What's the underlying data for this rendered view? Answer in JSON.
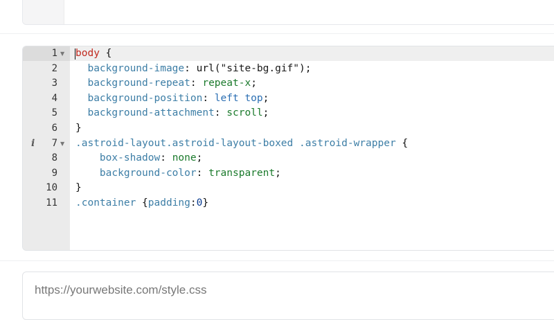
{
  "editor": {
    "lines": [
      {
        "num": "1",
        "fold": true,
        "info": false,
        "tokens": [
          [
            "sel",
            "body"
          ],
          [
            "brace",
            " {"
          ]
        ]
      },
      {
        "num": "2",
        "fold": false,
        "info": false,
        "tokens": [
          [
            "prop",
            "  background-image"
          ],
          [
            "brace",
            ": url("
          ],
          [
            "str",
            "\"site-bg.gif\""
          ],
          [
            "brace",
            ");"
          ]
        ]
      },
      {
        "num": "3",
        "fold": false,
        "info": false,
        "tokens": [
          [
            "prop",
            "  background-repeat"
          ],
          [
            "brace",
            ": "
          ],
          [
            "val",
            "repeat-x"
          ],
          [
            "brace",
            ";"
          ]
        ]
      },
      {
        "num": "4",
        "fold": false,
        "info": false,
        "tokens": [
          [
            "prop",
            "  background-position"
          ],
          [
            "brace",
            ": "
          ],
          [
            "kw",
            "left top"
          ],
          [
            "brace",
            ";"
          ]
        ]
      },
      {
        "num": "5",
        "fold": false,
        "info": false,
        "tokens": [
          [
            "prop",
            "  background-attachment"
          ],
          [
            "brace",
            ": "
          ],
          [
            "val",
            "scroll"
          ],
          [
            "brace",
            ";"
          ]
        ]
      },
      {
        "num": "6",
        "fold": false,
        "info": false,
        "tokens": [
          [
            "brace",
            "}"
          ]
        ]
      },
      {
        "num": "7",
        "fold": true,
        "info": true,
        "tokens": [
          [
            "cls",
            ".astroid-layout.astroid-layout-boxed .astroid-wrapper"
          ],
          [
            "brace",
            " {"
          ]
        ]
      },
      {
        "num": "8",
        "fold": false,
        "info": false,
        "tokens": [
          [
            "prop",
            "    box-shadow"
          ],
          [
            "brace",
            ": "
          ],
          [
            "val",
            "none"
          ],
          [
            "brace",
            ";"
          ]
        ]
      },
      {
        "num": "9",
        "fold": false,
        "info": false,
        "tokens": [
          [
            "prop",
            "    background-color"
          ],
          [
            "brace",
            ": "
          ],
          [
            "val",
            "transparent"
          ],
          [
            "brace",
            ";"
          ]
        ]
      },
      {
        "num": "10",
        "fold": false,
        "info": false,
        "tokens": [
          [
            "brace",
            "}"
          ]
        ]
      },
      {
        "num": "11",
        "fold": false,
        "info": false,
        "tokens": [
          [
            "cls",
            ".container"
          ],
          [
            "brace",
            " {"
          ],
          [
            "prop",
            "padding"
          ],
          [
            "brace",
            ":"
          ],
          [
            "num",
            "0"
          ],
          [
            "brace",
            "}"
          ]
        ]
      }
    ],
    "info_icon": "info-icon",
    "fold_icon": "fold-arrow-icon"
  },
  "url_field": {
    "placeholder": "https://yourwebsite.com/style.css",
    "value": ""
  }
}
